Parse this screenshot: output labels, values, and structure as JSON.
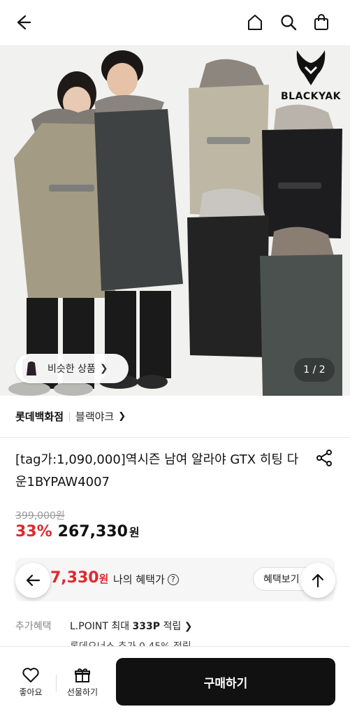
{
  "header": {
    "back_icon": "arrow-left-icon",
    "home_icon": "home-icon",
    "search_icon": "search-icon",
    "cart_icon": "shopping-bag-icon"
  },
  "gallery": {
    "brand_logo_text": "BLACKYAK",
    "similar_label": "비슷한 상품",
    "pager": "1 / 2"
  },
  "store": {
    "department": "롯데백화점",
    "brand": "블랙야크"
  },
  "product": {
    "title": "[tag가:1,090,000]역시즌 남여 알라야 GTX 히팅 다운1BYPAW4007",
    "original_price": "399,000원",
    "discount": "33%",
    "sale_price": "267,330",
    "currency": "원"
  },
  "benefit": {
    "amount": "7,330",
    "currency": "원",
    "my_label": "나의 혜택가",
    "view_button": "혜택보기"
  },
  "extra": {
    "label": "추가혜택",
    "lpoint_prefix": "L.POINT 최대 ",
    "lpoint_value": "333P",
    "lpoint_suffix": " 적립",
    "lotteon_line": "롯데오너스 추가 0.45% 적립"
  },
  "bottom": {
    "wish_label": "좋아요",
    "gift_label": "선물하기",
    "buy_label": "구매하기"
  },
  "colors": {
    "accent_red": "#e0282e",
    "buy_button": "#111111"
  }
}
